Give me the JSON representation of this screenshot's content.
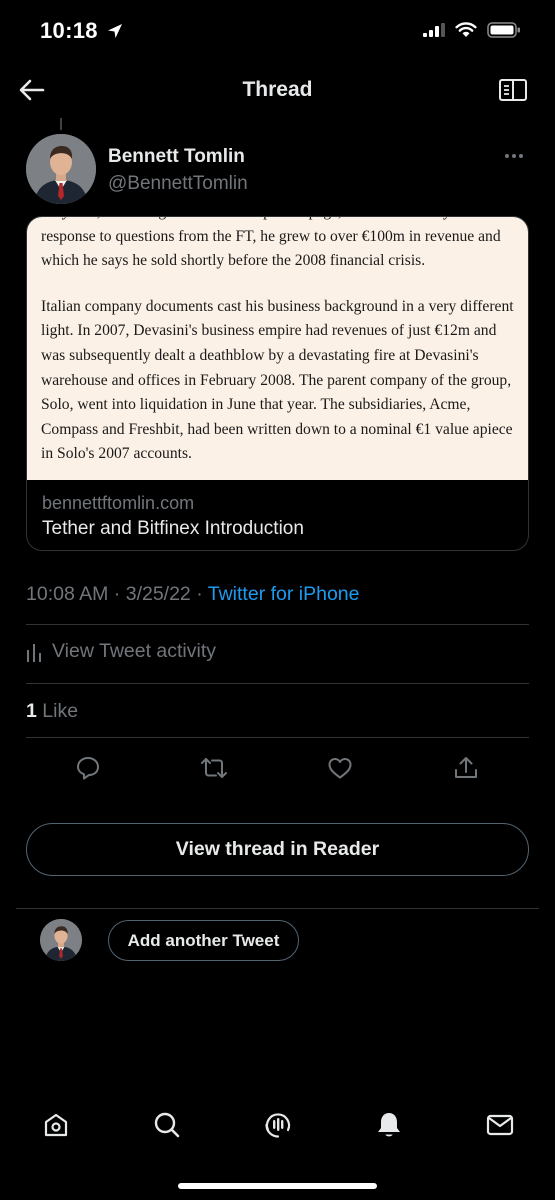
{
  "status_bar": {
    "time": "10:18"
  },
  "nav": {
    "title": "Thread"
  },
  "tweet": {
    "author_name": "Bennett Tomlin",
    "author_handle": "@BennettTomlin",
    "card": {
      "paragraphs": [
        "Italy that, according to his Bitfinex profile page, and reiterated by Tether in response to questions from the FT, he grew to over €100m in revenue and which he says he sold shortly before the 2008 financial crisis.",
        "Italian company documents cast his business background in a very different light. In 2007, Devasini's business empire had revenues of just €12m and was subsequently dealt a deathblow by a devastating fire at Devasini's warehouse and offices in February 2008. The parent company of the group, Solo, went into liquidation in June that year. The subsidiaries, Acme, Compass and Freshbit, had been written down to a nominal €1 value apiece in Solo's 2007 accounts."
      ],
      "domain": "bennettftomlin.com",
      "title": "Tether and Bitfinex Introduction"
    },
    "timestamp": "10:08 AM · 3/25/22 · ",
    "source": "Twitter for iPhone",
    "activity_label": "View Tweet activity",
    "like_count": "1",
    "like_label": " Like"
  },
  "reader_button": "View thread in Reader",
  "compose": {
    "add_tweet_label": "Add another Tweet"
  },
  "colors": {
    "background": "#000000",
    "text_primary": "#e7e9ea",
    "text_secondary": "#71767b",
    "accent": "#1d9bf0",
    "card_paper": "#fcf1e6"
  },
  "icons": {
    "tabs": [
      "home-icon",
      "search-icon",
      "spaces-icon",
      "notifications-icon",
      "messages-icon"
    ],
    "actions": [
      "reply-icon",
      "retweet-icon",
      "like-icon",
      "share-icon"
    ]
  }
}
